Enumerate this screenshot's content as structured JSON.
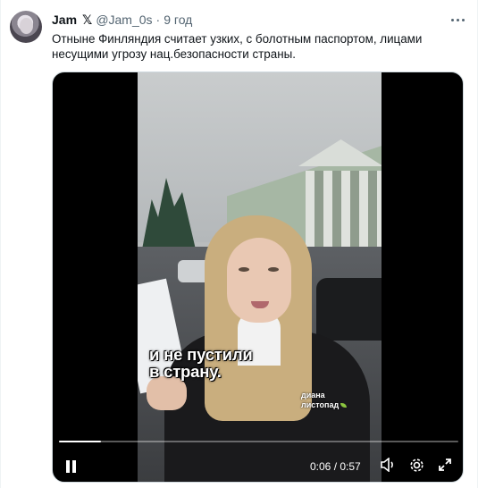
{
  "tweet": {
    "author_name": "Jam",
    "x_badge": "𝕏",
    "handle": "@Jam_0s",
    "separator": "·",
    "time": "9 год",
    "text": "Отныне Финляндия считает узких, с болотным паспортом, лицами несущими угрозу нац.безопасности страны."
  },
  "video": {
    "caption": "и не пустили\nв страну.",
    "watermark": "диана\nлистопад",
    "time_display": "0:06 / 0:57",
    "progress_fraction": 0.105,
    "icons": {
      "play_state": "pause-icon",
      "volume": "volume-icon",
      "settings": "gear-icon",
      "fullscreen": "expand-icon"
    }
  },
  "colors": {
    "text_primary": "#0f1419",
    "text_secondary": "#536471",
    "media_bg": "#000000"
  }
}
